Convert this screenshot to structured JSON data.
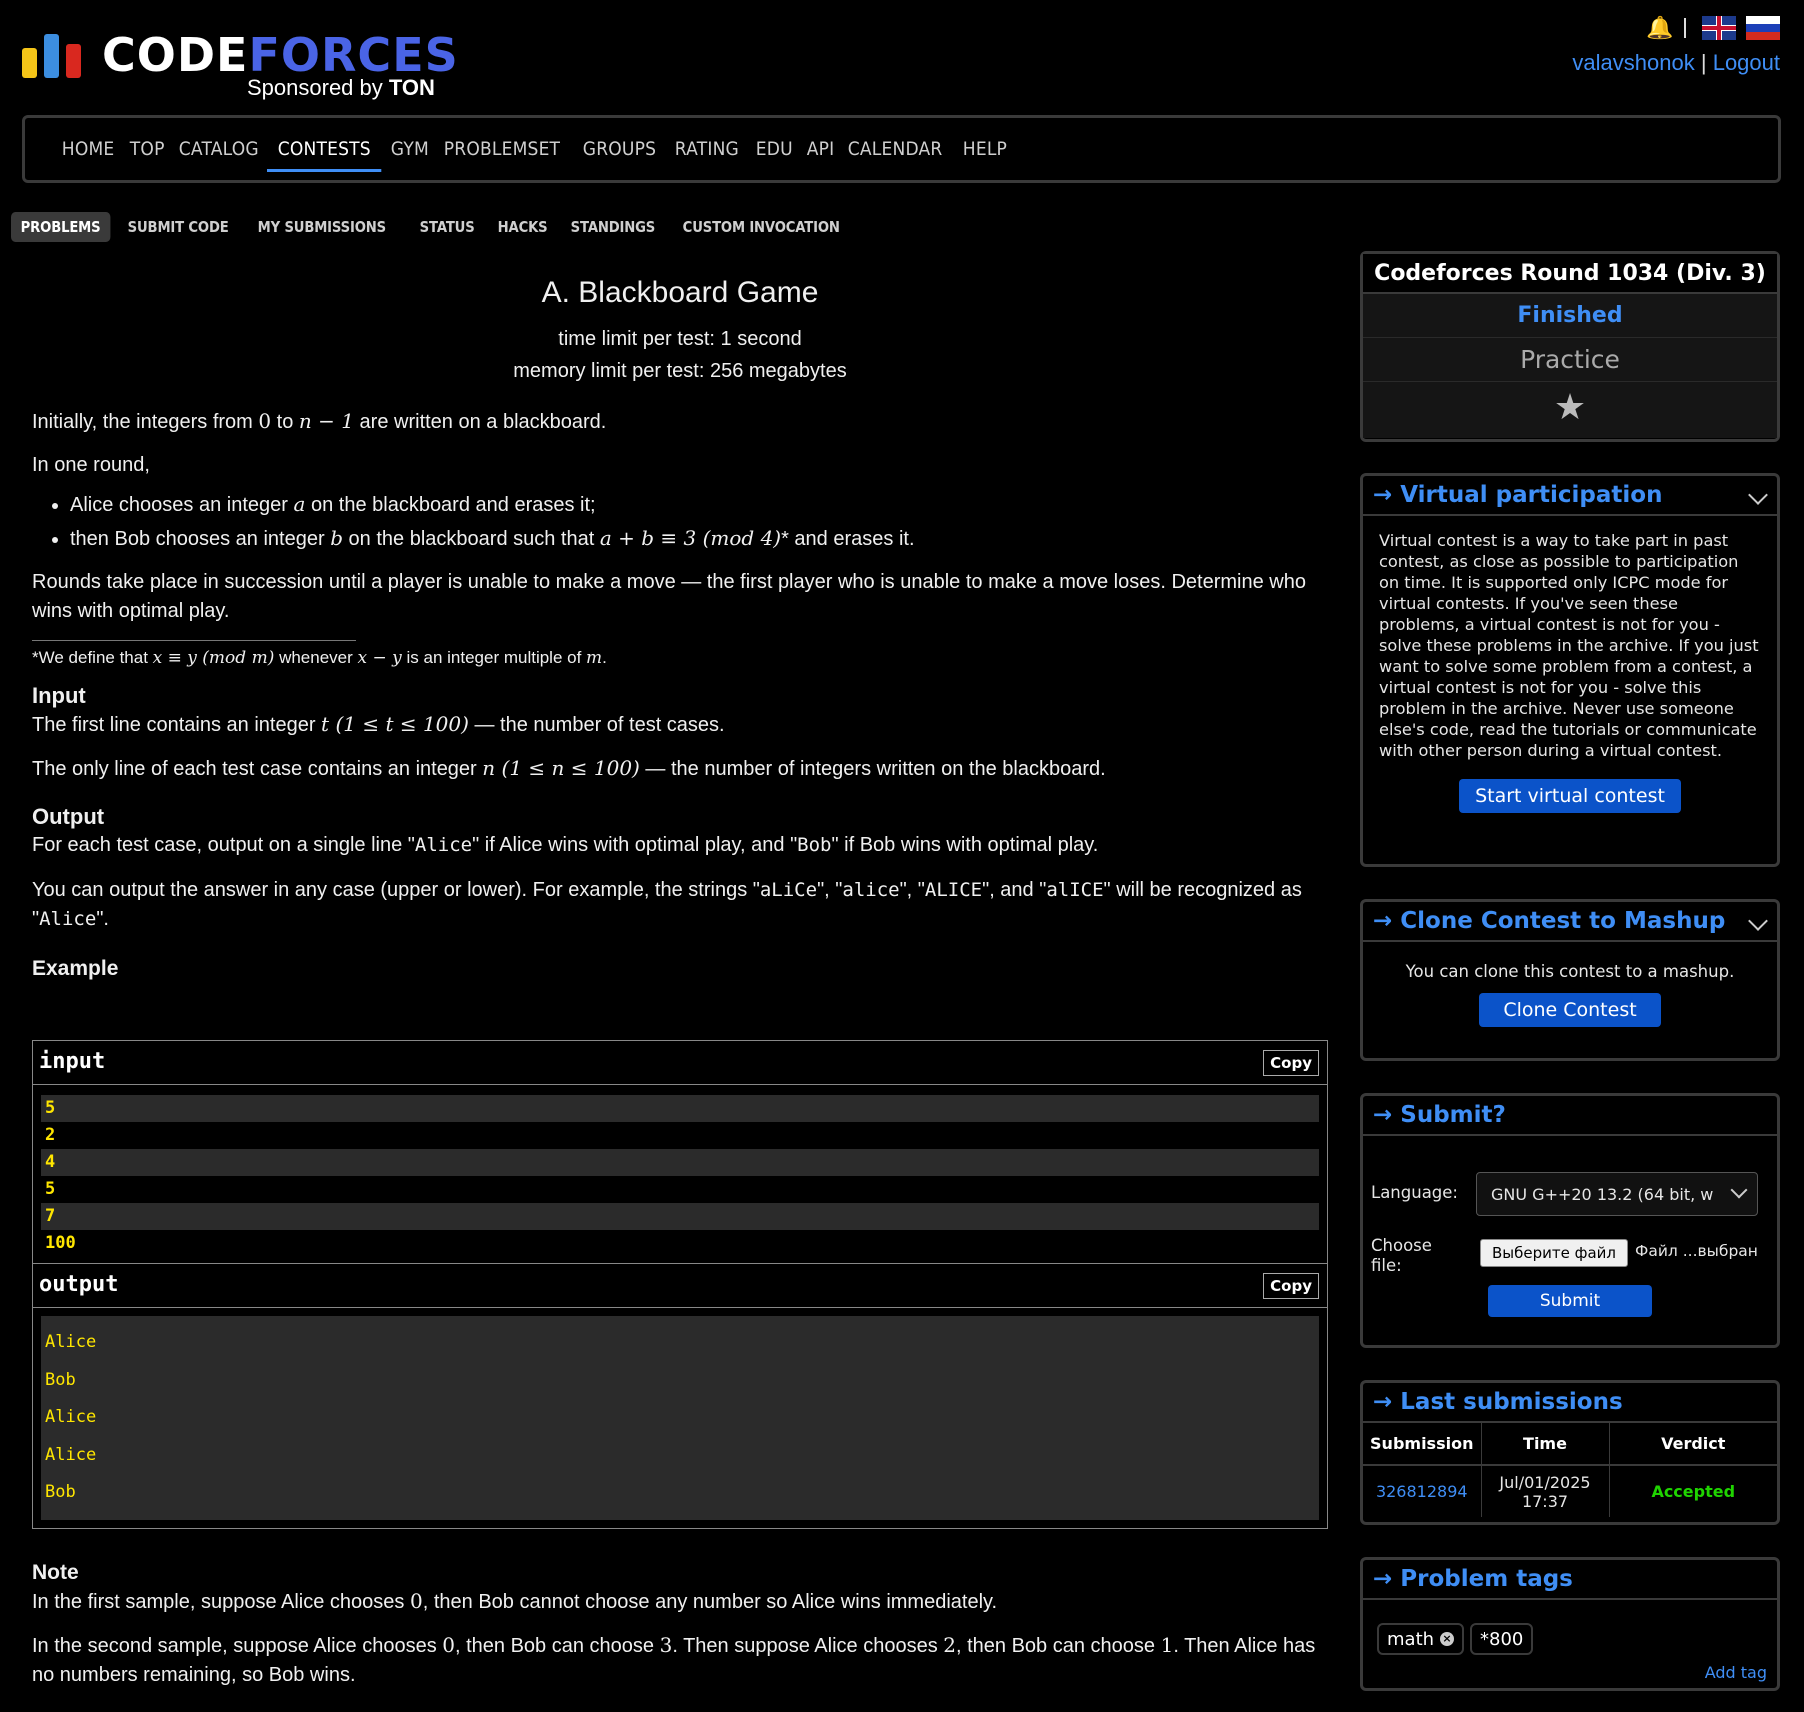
{
  "header": {
    "logo_code": "Code",
    "logo_forces": "forces",
    "sponsored_prefix": "Sponsored by ",
    "sponsored_brand": "TON",
    "username": "valavshonok",
    "logout": "Logout",
    "separator": "|"
  },
  "menu": [
    "HOME",
    "TOP",
    "CATALOG",
    "CONTESTS",
    "GYM",
    "PROBLEMSET",
    "GROUPS",
    "RATING",
    "EDU",
    "API",
    "CALENDAR",
    "HELP"
  ],
  "menu_active": "CONTESTS",
  "submenu": [
    "PROBLEMS",
    "SUBMIT CODE",
    "MY SUBMISSIONS",
    "STATUS",
    "HACKS",
    "STANDINGS",
    "CUSTOM INVOCATION"
  ],
  "submenu_active": "PROBLEMS",
  "problem": {
    "title": "A. Blackboard Game",
    "time_limit": "time limit per test: 1 second",
    "memory_limit": "memory limit per test: 256 megabytes",
    "intro_1": "Initially, the integers from ",
    "intro_m1": "0",
    "intro_2": " to ",
    "intro_m2": "n − 1",
    "intro_3": " are written on a blackboard.",
    "round_intro": "In one round,",
    "rule1_a": "Alice chooses an integer ",
    "rule1_m": "a",
    "rule1_b": " on the blackboard and erases it;",
    "rule2_a": "then Bob chooses an integer ",
    "rule2_m1": "b",
    "rule2_b": " on the blackboard such that ",
    "rule2_m2": "a + b ≡ 3  (mod  4)",
    "rule2_c": "* and erases it.",
    "rounds_text": "Rounds take place in succession until a player is unable to make a move — the first player who is unable to make a move loses. Determine who wins with optimal play.",
    "footnote_a": "*We define that ",
    "footnote_m1": "x ≡ y  (mod  m)",
    "footnote_b": " whenever ",
    "footnote_m2": "x − y",
    "footnote_c": " is an integer multiple of ",
    "footnote_m3": "m",
    "footnote_d": ".",
    "input_title": "Input",
    "input_1a": "The first line contains an integer ",
    "input_1m": "t (1 ≤ t ≤ 100)",
    "input_1b": " — the number of test cases.",
    "input_2a": "The only line of each test case contains an integer ",
    "input_2m": "n (1 ≤ n ≤ 100)",
    "input_2b": " — the number of integers written on the blackboard.",
    "output_title": "Output",
    "output_1a": "For each test case, output on a single line \"",
    "output_1m1": "Alice",
    "output_1b": "\" if Alice wins with optimal play, and \"",
    "output_1m2": "Bob",
    "output_1c": "\" if Bob wins with optimal play.",
    "output_2a": "You can output the answer in any case (upper or lower). For example, the strings \"",
    "output_2m1": "aLiCe",
    "output_2b": "\", \"",
    "output_2m2": "alice",
    "output_2c": "\", \"",
    "output_2m3": "ALICE",
    "output_2d": "\", and \"",
    "output_2m4": "alICE",
    "output_2e": "\" will be recognized as \"",
    "output_2m5": "Alice",
    "output_2f": "\".",
    "example_title": "Example",
    "input_label": "input",
    "output_label": "output",
    "copy": "Copy",
    "input_lines": [
      "5",
      "2",
      "4",
      "5",
      "7",
      "100"
    ],
    "output_lines": [
      "Alice",
      "Bob",
      "Alice",
      "Alice",
      "Bob"
    ],
    "note_title": "Note",
    "note_1a": "In the first sample, suppose Alice chooses ",
    "note_1m": "0",
    "note_1b": ", then Bob cannot choose any number so Alice wins immediately.",
    "note_2a": "In the second sample, suppose Alice chooses ",
    "note_2m1": "0",
    "note_2b": ", then Bob can choose ",
    "note_2m2": "3",
    "note_2c": ". Then suppose Alice chooses ",
    "note_2m3": "2",
    "note_2d": ", then Bob can choose ",
    "note_2m4": "1",
    "note_2e": ". Then Alice has no numbers remaining, so Bob wins."
  },
  "sidebar": {
    "round_name": "Codeforces Round 1034 (Div. 3)",
    "round_status": "Finished",
    "round_practice": "Practice",
    "virtual_title": "→ Virtual participation",
    "virtual_text": "Virtual contest is a way to take part in past contest, as close as possible to participation on time. It is supported only ICPC mode for virtual contests. If you've seen these problems, a virtual contest is not for you - solve these problems in the archive. If you just want to solve some problem from a contest, a virtual contest is not for you - solve this problem in the archive. Never use someone else's code, read the tutorials or communicate with other person during a virtual contest.",
    "virtual_button": "Start virtual contest",
    "clone_title": "→ Clone Contest to Mashup",
    "clone_text": "You can clone this contest to a mashup.",
    "clone_button": "Clone Contest",
    "submit_title": "→ Submit?",
    "language_label": "Language:",
    "language_value": "GNU G++20 13.2 (64 bit, w",
    "choose_file_label": "Choose file:",
    "file_button": "Выберите файл",
    "file_status": "Файл ...выбран",
    "submit_button": "Submit",
    "last_title": "→ Last submissions",
    "last_headers": [
      "Submission",
      "Time",
      "Verdict"
    ],
    "last_row": {
      "id": "326812894",
      "time_date": "Jul/01/2025",
      "time_clock": "17:37",
      "verdict": "Accepted"
    },
    "tags_title": "→ Problem tags",
    "tags": [
      "math",
      "*800"
    ],
    "add_tag": "Add tag"
  },
  "colors": {
    "accent_blue": "#3f8ef5",
    "verdict_green": "#1fd400",
    "sample_yellow": "#ffe600",
    "logo_bar_yellow": "#f5c518",
    "logo_bar_blue": "#3c8ee0",
    "logo_bar_red": "#d9281f"
  }
}
